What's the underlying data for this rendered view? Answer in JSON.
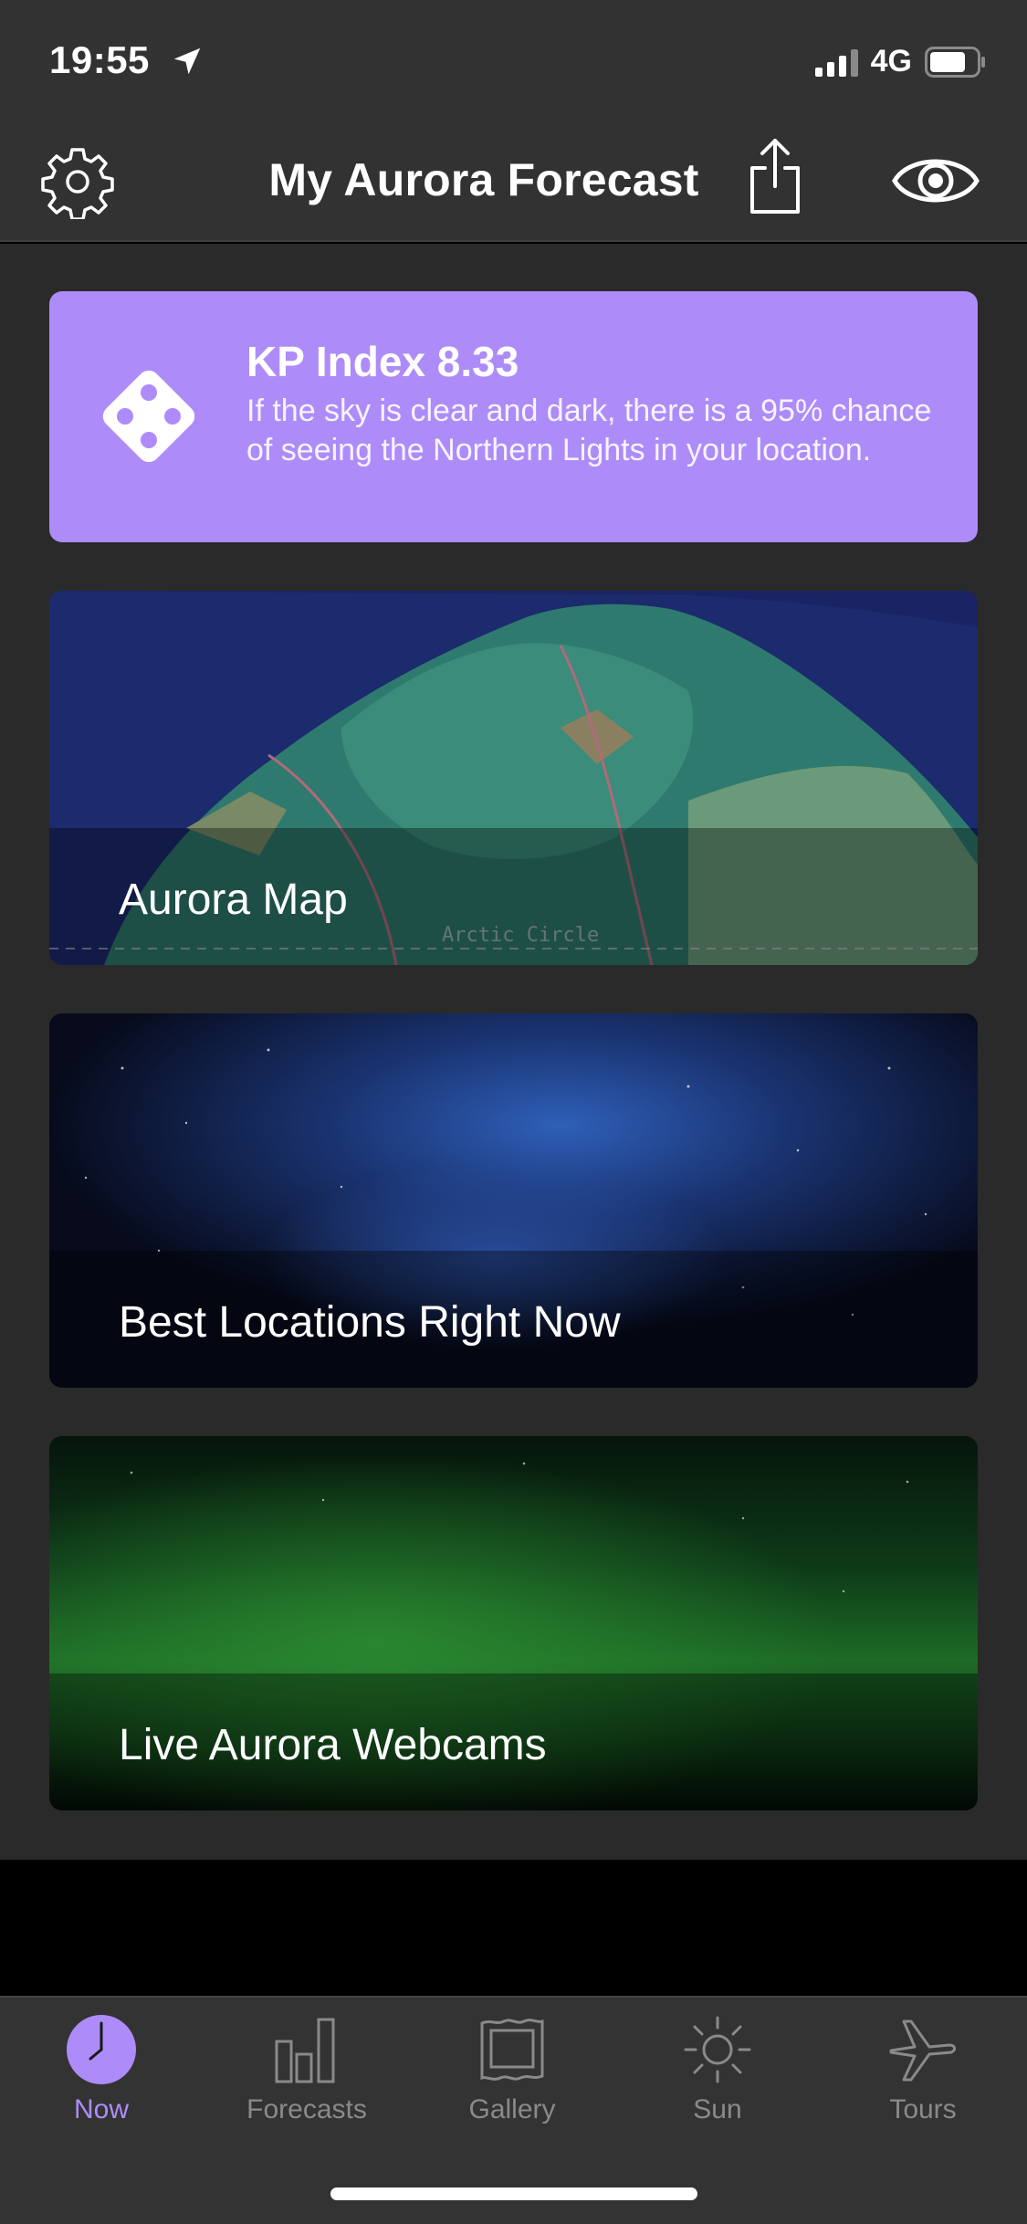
{
  "status_bar": {
    "time": "19:55",
    "network": "4G"
  },
  "nav": {
    "title": "My Aurora Forecast"
  },
  "kp_card": {
    "title": "KP Index 8.33",
    "description": "If the sky is clear and dark, there is a 95% chance of seeing the Northern Lights in your location."
  },
  "cards": {
    "map": {
      "label": "Aurora Map",
      "map_label": "Arctic Circle"
    },
    "locations": {
      "label": "Best Locations Right Now"
    },
    "webcams": {
      "label": "Live Aurora Webcams"
    }
  },
  "tabs": [
    {
      "label": "Now",
      "icon": "clock-icon",
      "active": true
    },
    {
      "label": "Forecasts",
      "icon": "bar-chart-icon",
      "active": false
    },
    {
      "label": "Gallery",
      "icon": "picture-frame-icon",
      "active": false
    },
    {
      "label": "Sun",
      "icon": "sun-icon",
      "active": false
    },
    {
      "label": "Tours",
      "icon": "airplane-icon",
      "active": false
    }
  ],
  "colors": {
    "accent": "#ad8cf9",
    "nav_background": "#323232",
    "content_background": "#2a2a2a",
    "tab_inactive": "#8a8a8a"
  }
}
